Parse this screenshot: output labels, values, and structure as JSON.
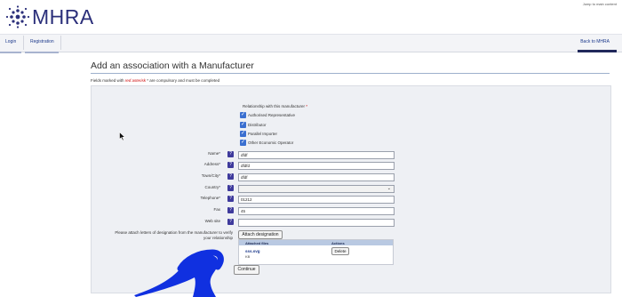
{
  "header": {
    "brand": "MHRA",
    "skip_link": "Jump to main content",
    "nav": {
      "login": "Login",
      "registration": "Registration",
      "back": "Back to MHRA"
    }
  },
  "page": {
    "title": "Add an association with a Manufacturer",
    "mandatory_prefix": "Fields marked with ",
    "mandatory_emph": "red asterisk",
    "mandatory_suffix": " * are compulsory and must be completed"
  },
  "relationship": {
    "label": "Relationship with this manufacturer",
    "required_mark": " *",
    "options": [
      {
        "label": "Authorised Representative",
        "checked": true
      },
      {
        "label": "Distributor",
        "checked": true
      },
      {
        "label": "Parallel Importer",
        "checked": true
      },
      {
        "label": "Other Economic Operator",
        "checked": true
      }
    ]
  },
  "form": {
    "name_label": "Name*",
    "name_value": "dfdf",
    "address_label": "Address*",
    "address_value": "dfdfd",
    "town_label": "Town/City*",
    "town_value": "dfdf",
    "country_label": "Country*",
    "country_value": "",
    "telephone_label": "Telephone*",
    "telephone_value": "01212",
    "fax_label": "Fax",
    "fax_value": "45",
    "website_label": "Web site",
    "website_value": ""
  },
  "attachments": {
    "note": "Please attach letters of designation from the manufacturer to verify your relationship",
    "attach_button": "Attach designation",
    "col_files": "Attached files",
    "col_actions": "Actions",
    "file_name": "sss.svg",
    "file_size": "KB",
    "delete_button": "Delete"
  },
  "continue_button": "Continue",
  "colors": {
    "brand_navy": "#2b2f7a",
    "help_purple": "#3e3a9c",
    "checkbox_blue": "#3a6fd0",
    "scribble_blue": "#1030e0"
  }
}
